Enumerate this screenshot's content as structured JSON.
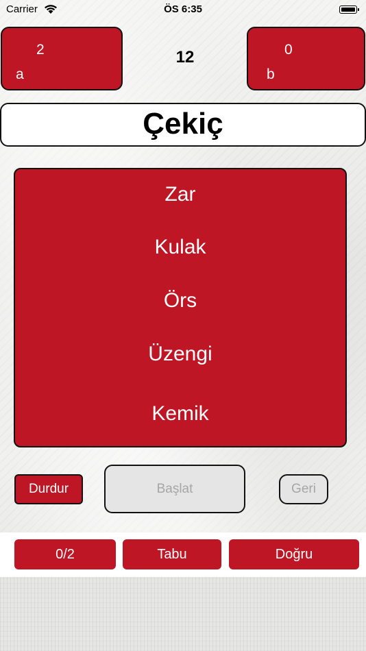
{
  "status_bar": {
    "carrier": "Carrier",
    "time": "ÖS 6:35"
  },
  "team_a": {
    "score": "2",
    "name": "a"
  },
  "team_b": {
    "score": "0",
    "name": "b"
  },
  "timer": "12",
  "current_word": "Çekiç",
  "taboo_words": [
    "Zar",
    "Kulak",
    "Örs",
    "Üzengi",
    "Kemik"
  ],
  "controls": {
    "stop_label": "Durdur",
    "start_label": "Başlat",
    "back_label": "Geri"
  },
  "bottom_bar": {
    "pass_count": "0/2",
    "taboo_label": "Tabu",
    "correct_label": "Doğru"
  },
  "colors": {
    "accent_red": "#be1624",
    "disabled_gray": "#e5e5e5"
  }
}
